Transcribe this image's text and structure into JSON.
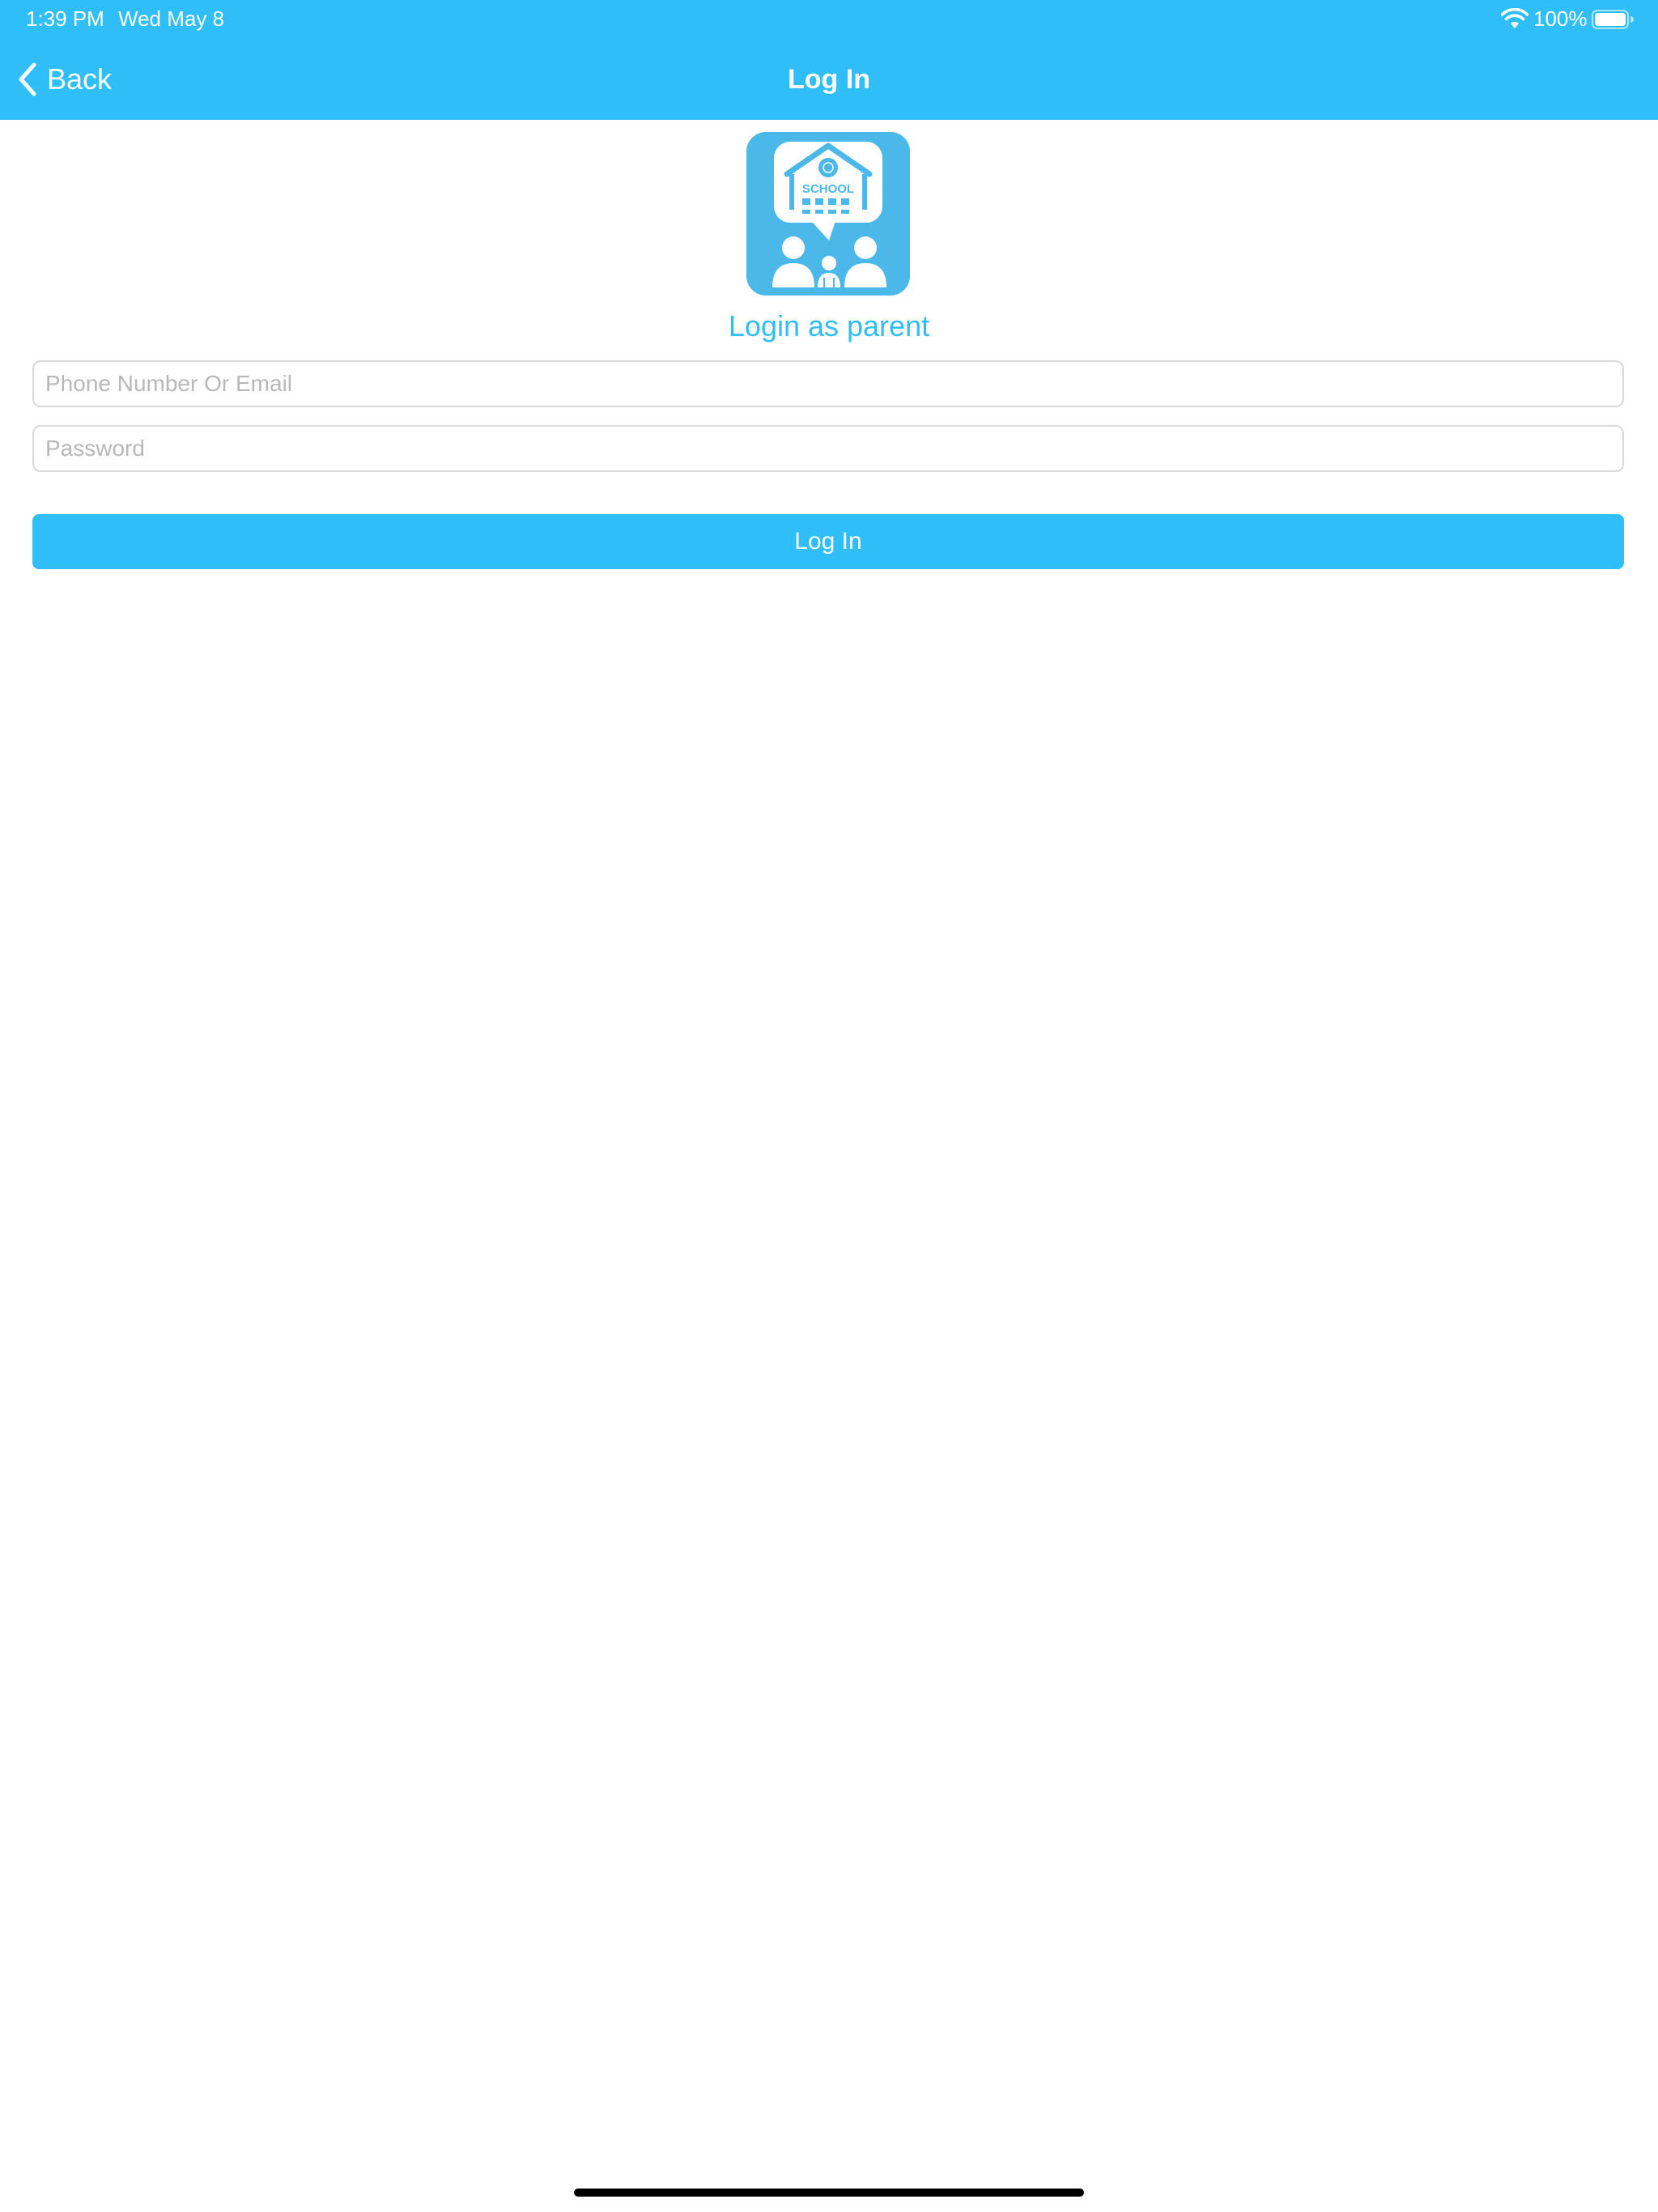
{
  "status_bar": {
    "time": "1:39 PM",
    "date": "Wed May 8",
    "battery": "100%"
  },
  "nav": {
    "back_label": "Back",
    "title": "Log In"
  },
  "logo": {
    "school_label": "SCHOOL"
  },
  "login": {
    "subtitle": "Login as parent",
    "phone_placeholder": "Phone Number Or Email",
    "password_placeholder": "Password",
    "submit_label": "Log In"
  },
  "colors": {
    "accent": "#30BEF9",
    "logo_bg": "#4AB8E8",
    "field_border": "#DADADA",
    "placeholder": "#B8B8B8"
  },
  "icons": [
    "wifi-icon",
    "battery-icon",
    "chevron-left-icon",
    "school-parents-logo"
  ]
}
